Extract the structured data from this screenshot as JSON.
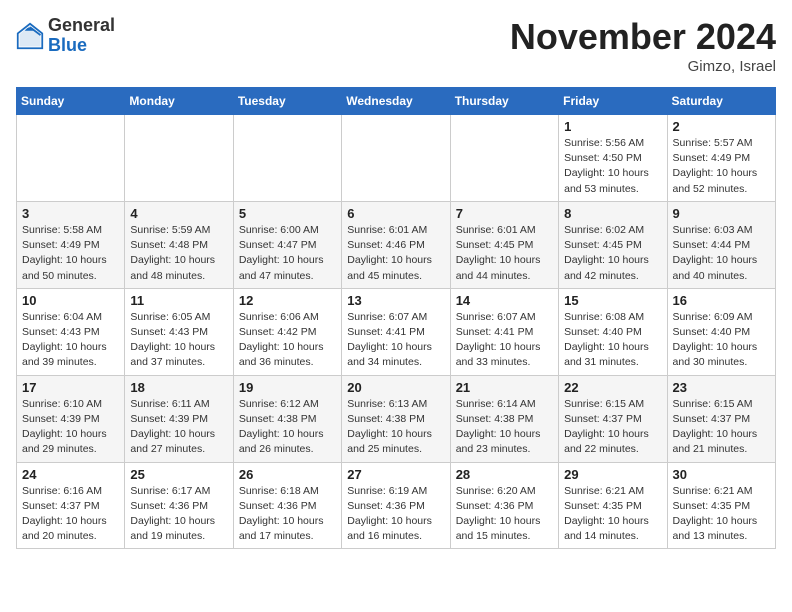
{
  "header": {
    "logo_general": "General",
    "logo_blue": "Blue",
    "month_title": "November 2024",
    "location": "Gimzo, Israel"
  },
  "weekdays": [
    "Sunday",
    "Monday",
    "Tuesday",
    "Wednesday",
    "Thursday",
    "Friday",
    "Saturday"
  ],
  "weeks": [
    [
      {
        "day": "",
        "info": ""
      },
      {
        "day": "",
        "info": ""
      },
      {
        "day": "",
        "info": ""
      },
      {
        "day": "",
        "info": ""
      },
      {
        "day": "",
        "info": ""
      },
      {
        "day": "1",
        "info": "Sunrise: 5:56 AM\nSunset: 4:50 PM\nDaylight: 10 hours\nand 53 minutes."
      },
      {
        "day": "2",
        "info": "Sunrise: 5:57 AM\nSunset: 4:49 PM\nDaylight: 10 hours\nand 52 minutes."
      }
    ],
    [
      {
        "day": "3",
        "info": "Sunrise: 5:58 AM\nSunset: 4:49 PM\nDaylight: 10 hours\nand 50 minutes."
      },
      {
        "day": "4",
        "info": "Sunrise: 5:59 AM\nSunset: 4:48 PM\nDaylight: 10 hours\nand 48 minutes."
      },
      {
        "day": "5",
        "info": "Sunrise: 6:00 AM\nSunset: 4:47 PM\nDaylight: 10 hours\nand 47 minutes."
      },
      {
        "day": "6",
        "info": "Sunrise: 6:01 AM\nSunset: 4:46 PM\nDaylight: 10 hours\nand 45 minutes."
      },
      {
        "day": "7",
        "info": "Sunrise: 6:01 AM\nSunset: 4:45 PM\nDaylight: 10 hours\nand 44 minutes."
      },
      {
        "day": "8",
        "info": "Sunrise: 6:02 AM\nSunset: 4:45 PM\nDaylight: 10 hours\nand 42 minutes."
      },
      {
        "day": "9",
        "info": "Sunrise: 6:03 AM\nSunset: 4:44 PM\nDaylight: 10 hours\nand 40 minutes."
      }
    ],
    [
      {
        "day": "10",
        "info": "Sunrise: 6:04 AM\nSunset: 4:43 PM\nDaylight: 10 hours\nand 39 minutes."
      },
      {
        "day": "11",
        "info": "Sunrise: 6:05 AM\nSunset: 4:43 PM\nDaylight: 10 hours\nand 37 minutes."
      },
      {
        "day": "12",
        "info": "Sunrise: 6:06 AM\nSunset: 4:42 PM\nDaylight: 10 hours\nand 36 minutes."
      },
      {
        "day": "13",
        "info": "Sunrise: 6:07 AM\nSunset: 4:41 PM\nDaylight: 10 hours\nand 34 minutes."
      },
      {
        "day": "14",
        "info": "Sunrise: 6:07 AM\nSunset: 4:41 PM\nDaylight: 10 hours\nand 33 minutes."
      },
      {
        "day": "15",
        "info": "Sunrise: 6:08 AM\nSunset: 4:40 PM\nDaylight: 10 hours\nand 31 minutes."
      },
      {
        "day": "16",
        "info": "Sunrise: 6:09 AM\nSunset: 4:40 PM\nDaylight: 10 hours\nand 30 minutes."
      }
    ],
    [
      {
        "day": "17",
        "info": "Sunrise: 6:10 AM\nSunset: 4:39 PM\nDaylight: 10 hours\nand 29 minutes."
      },
      {
        "day": "18",
        "info": "Sunrise: 6:11 AM\nSunset: 4:39 PM\nDaylight: 10 hours\nand 27 minutes."
      },
      {
        "day": "19",
        "info": "Sunrise: 6:12 AM\nSunset: 4:38 PM\nDaylight: 10 hours\nand 26 minutes."
      },
      {
        "day": "20",
        "info": "Sunrise: 6:13 AM\nSunset: 4:38 PM\nDaylight: 10 hours\nand 25 minutes."
      },
      {
        "day": "21",
        "info": "Sunrise: 6:14 AM\nSunset: 4:38 PM\nDaylight: 10 hours\nand 23 minutes."
      },
      {
        "day": "22",
        "info": "Sunrise: 6:15 AM\nSunset: 4:37 PM\nDaylight: 10 hours\nand 22 minutes."
      },
      {
        "day": "23",
        "info": "Sunrise: 6:15 AM\nSunset: 4:37 PM\nDaylight: 10 hours\nand 21 minutes."
      }
    ],
    [
      {
        "day": "24",
        "info": "Sunrise: 6:16 AM\nSunset: 4:37 PM\nDaylight: 10 hours\nand 20 minutes."
      },
      {
        "day": "25",
        "info": "Sunrise: 6:17 AM\nSunset: 4:36 PM\nDaylight: 10 hours\nand 19 minutes."
      },
      {
        "day": "26",
        "info": "Sunrise: 6:18 AM\nSunset: 4:36 PM\nDaylight: 10 hours\nand 17 minutes."
      },
      {
        "day": "27",
        "info": "Sunrise: 6:19 AM\nSunset: 4:36 PM\nDaylight: 10 hours\nand 16 minutes."
      },
      {
        "day": "28",
        "info": "Sunrise: 6:20 AM\nSunset: 4:36 PM\nDaylight: 10 hours\nand 15 minutes."
      },
      {
        "day": "29",
        "info": "Sunrise: 6:21 AM\nSunset: 4:35 PM\nDaylight: 10 hours\nand 14 minutes."
      },
      {
        "day": "30",
        "info": "Sunrise: 6:21 AM\nSunset: 4:35 PM\nDaylight: 10 hours\nand 13 minutes."
      }
    ]
  ]
}
